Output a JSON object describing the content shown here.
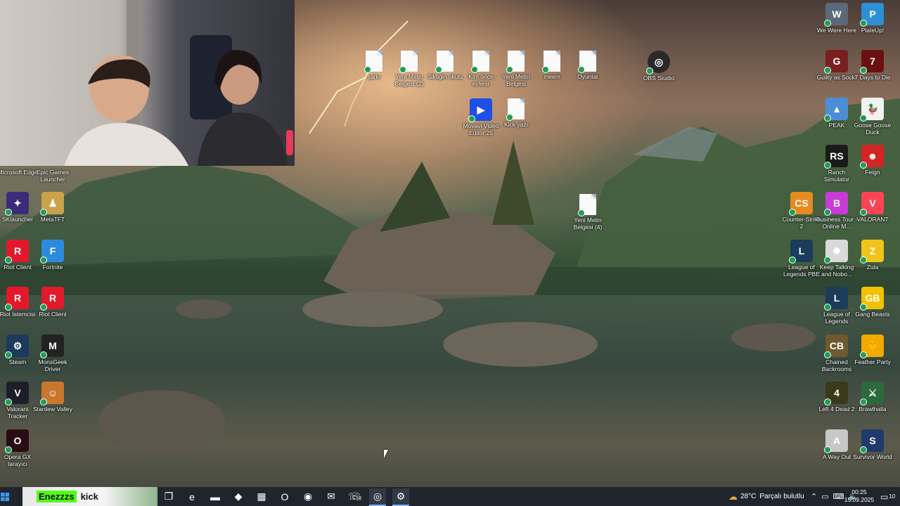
{
  "desktop_icons_left": [
    {
      "label": "Microsoft Edge",
      "icon": "edge-icon",
      "color": "#1677d6",
      "glyph": "e"
    },
    {
      "label": "Epic Games Launcher",
      "icon": "epic-games-icon",
      "color": "#2a2a2a",
      "glyph": "EPIC"
    },
    {
      "label": "SKlauncher",
      "icon": "sklauncher-icon",
      "color": "#3b2c7a",
      "glyph": "✦"
    },
    {
      "label": "MetaTFT",
      "icon": "metatft-icon",
      "color": "#c9a24a",
      "glyph": "♟"
    },
    {
      "label": "Riot Client",
      "icon": "riot-client-icon",
      "color": "#e2192b",
      "glyph": "R"
    },
    {
      "label": "Fortnite",
      "icon": "fortnite-icon",
      "color": "#2d8bde",
      "glyph": "F"
    },
    {
      "label": "Riot İstemcisi",
      "icon": "riot-client-icon",
      "color": "#e2192b",
      "glyph": "R"
    },
    {
      "label": "Riot Client",
      "icon": "riot-client-icon",
      "color": "#e2192b",
      "glyph": "R"
    },
    {
      "label": "Steam",
      "icon": "steam-icon",
      "color": "#1b3a5c",
      "glyph": "⚙"
    },
    {
      "label": "MonsGeek Driver",
      "icon": "monsgeek-icon",
      "color": "#222222",
      "glyph": "M"
    },
    {
      "label": "Valorant Tracker",
      "icon": "valorant-tracker-icon",
      "color": "#1e1e2a",
      "glyph": "V"
    },
    {
      "label": "Stardew Valley",
      "icon": "stardew-icon",
      "color": "#c9772e",
      "glyph": "☺"
    },
    {
      "label": "Opera GX tarayıcı",
      "icon": "opera-gx-icon",
      "color": "#2b0c14",
      "glyph": "O"
    }
  ],
  "desktop_icons_center": [
    {
      "label": "şarkı",
      "icon": "document-icon"
    },
    {
      "label": "Yeni Metin Belgesi (2)",
      "icon": "document-icon"
    },
    {
      "label": "Siktiğin okulu",
      "icon": "document-icon"
    },
    {
      "label": "Kim önce evlenir",
      "icon": "document-icon"
    },
    {
      "label": "Yeni Metin Belgesi",
      "icon": "document-icon"
    },
    {
      "label": "meem",
      "icon": "document-icon"
    },
    {
      "label": "Oyunlar",
      "icon": "document-icon"
    },
    {
      "label": "OBS Studio",
      "icon": "obs-icon"
    },
    {
      "label": "Movavi Video Editor 25",
      "icon": "movavi-icon"
    },
    {
      "label": "Kick yazı",
      "icon": "document-icon"
    },
    {
      "label": "Yeni Metin Belgesi (4)",
      "icon": "document-icon"
    }
  ],
  "desktop_icons_right": [
    {
      "label": "We Were Here",
      "icon": "we-were-here-icon",
      "color": "#5a6a7a",
      "glyph": "W"
    },
    {
      "label": "PlateUp!",
      "icon": "plateup-icon",
      "color": "#2d8fd6",
      "glyph": "P"
    },
    {
      "label": "Guilty as Sock!",
      "icon": "guilty-as-sock-icon",
      "color": "#7a1f1f",
      "glyph": "G"
    },
    {
      "label": "7 Days to Die",
      "icon": "7-days-to-die-icon",
      "color": "#6a1010",
      "glyph": "7"
    },
    {
      "label": "PEAK",
      "icon": "peak-icon",
      "color": "#4a8fd6",
      "glyph": "▲"
    },
    {
      "label": "Goose Goose Duck",
      "icon": "goose-goose-duck-icon",
      "color": "#f2f2f2",
      "glyph": "🦆"
    },
    {
      "label": "Ranch Simulator",
      "icon": "ranch-simulator-icon",
      "color": "#1a1a1a",
      "glyph": "RS"
    },
    {
      "label": "Feign",
      "icon": "feign-icon",
      "color": "#d42424",
      "glyph": "☻"
    },
    {
      "label": "Counter-Strike 2",
      "icon": "counter-strike-icon",
      "color": "#e58b1f",
      "glyph": "CS"
    },
    {
      "label": "Business Tour - Online M...",
      "icon": "business-tour-icon",
      "color": "#c93bd6",
      "glyph": "B"
    },
    {
      "label": "VALORANT",
      "icon": "valorant-icon",
      "color": "#fa4454",
      "glyph": "V"
    },
    {
      "label": "League of Legends PBE",
      "icon": "lol-pbe-icon",
      "color": "#1b3c5a",
      "glyph": "L"
    },
    {
      "label": "Keep Talking and Nobo...",
      "icon": "keep-talking-icon",
      "color": "#d9d9d9",
      "glyph": "✹"
    },
    {
      "label": "Zula",
      "icon": "zula-icon",
      "color": "#f0c419",
      "glyph": "Z"
    },
    {
      "label": "League of Legends",
      "icon": "lol-icon",
      "color": "#1b3c5a",
      "glyph": "L"
    },
    {
      "label": "Gang Beasts",
      "icon": "gang-beasts-icon",
      "color": "#f2c200",
      "glyph": "GB"
    },
    {
      "label": "Chained Backrooms",
      "icon": "chained-backrooms-icon",
      "color": "#6e5a2e",
      "glyph": "CB"
    },
    {
      "label": "Feather Party",
      "icon": "feather-party-icon",
      "color": "#f2a900",
      "glyph": "🐥"
    },
    {
      "label": "Left 4 Dead 2",
      "icon": "left-4-dead-2-icon",
      "color": "#3a3a1a",
      "glyph": "4"
    },
    {
      "label": "Brawlhalla",
      "icon": "brawlhalla-icon",
      "color": "#2b6a3a",
      "glyph": "⚔"
    },
    {
      "label": "A Way Out",
      "icon": "a-way-out-icon",
      "color": "#c7c7c7",
      "glyph": "A"
    },
    {
      "label": "Survivor World",
      "icon": "survivor-world-icon",
      "color": "#1f3b6a",
      "glyph": "S"
    }
  ],
  "taskbar": {
    "kick_overlay": {
      "username": "Enezzzs",
      "brand": "kick"
    },
    "apps": [
      {
        "name": "task-view-icon",
        "glyph": "❐"
      },
      {
        "name": "edge-icon",
        "glyph": "e"
      },
      {
        "name": "file-explorer-icon",
        "glyph": "▬"
      },
      {
        "name": "copilot-icon",
        "glyph": "◆"
      },
      {
        "name": "store-icon",
        "glyph": "▦"
      },
      {
        "name": "opera-gx-icon",
        "glyph": "O"
      },
      {
        "name": "chrome-icon",
        "glyph": "◉"
      },
      {
        "name": "outlook-icon",
        "glyph": "✉"
      },
      {
        "name": "whatsapp-icon",
        "glyph": "☏",
        "badge": "18"
      },
      {
        "name": "obs-icon",
        "glyph": "◎"
      },
      {
        "name": "steam-icon",
        "glyph": "⚙"
      }
    ],
    "weather": {
      "temp": "28°C",
      "condition": "Parçalı bulutlu"
    },
    "clock": {
      "time": "00:25",
      "date": "15.09.2025"
    },
    "notifications_count": "10"
  }
}
